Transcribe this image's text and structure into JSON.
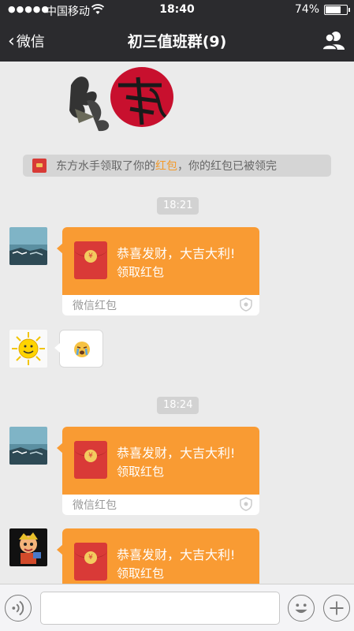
{
  "status_bar": {
    "signal": "●●●●●",
    "carrier": "中国移动",
    "time": "18:40",
    "battery": "74%",
    "battery_level": 0.74
  },
  "nav": {
    "back_label": "微信",
    "title": "初三值班群(9)"
  },
  "system_notice": {
    "before": "东方水手领取了你的",
    "link": "红包",
    "after": "，你的红包已被领完"
  },
  "messages": {
    "time1": "18:21",
    "time2": "18:24",
    "rp1": {
      "wish": "恭喜发财，大吉大利!",
      "claim": "领取红包",
      "brand": "微信红包"
    },
    "rp2": {
      "wish": "恭喜发财，大吉大利!",
      "claim": "领取红包",
      "brand": "微信红包"
    },
    "rp3": {
      "wish": "恭喜发财，大吉大利!",
      "claim": "领取红包"
    }
  },
  "input": {
    "value": "",
    "placeholder": ""
  },
  "colors": {
    "nav_bg": "#2b2b2e",
    "chat_bg": "#ebebeb",
    "redpacket_orange": "#f99b33",
    "envelope_red": "#d93a37"
  },
  "icons": {
    "back": "chevron-left-icon",
    "profile": "group-profile-icon",
    "voice": "voice-icon",
    "emoji": "smiley-icon",
    "plus": "plus-icon",
    "shield": "shield-icon"
  }
}
